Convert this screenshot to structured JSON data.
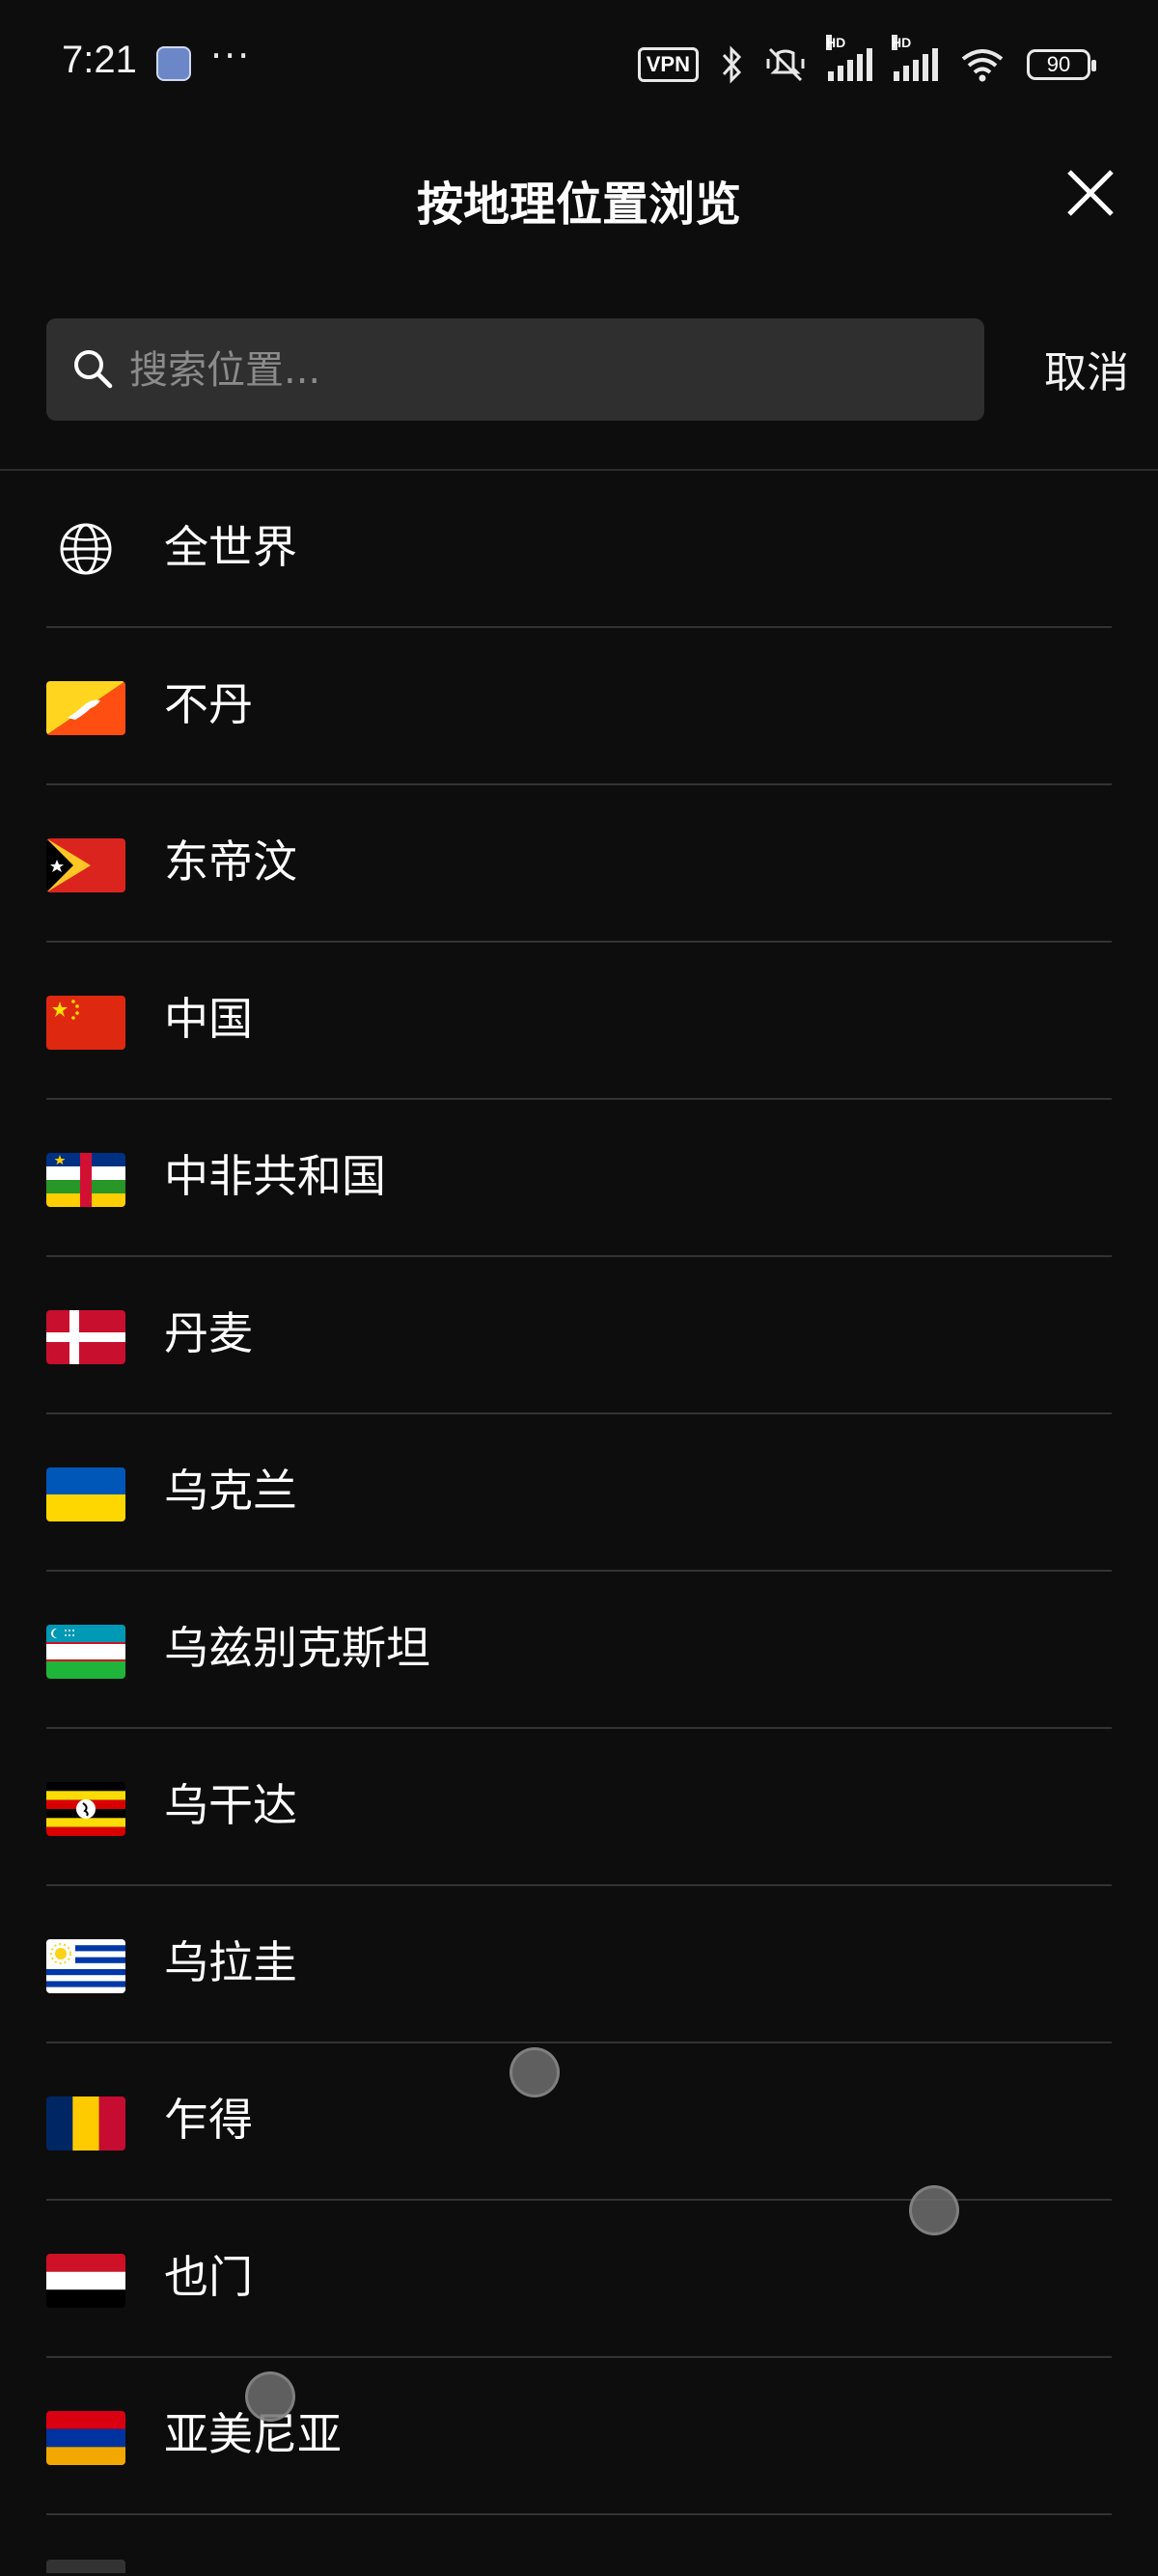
{
  "status_bar": {
    "time": "7:21",
    "app_icon": "news-app-icon",
    "overflow": "···",
    "vpn": "VPN",
    "hd1": "HD",
    "hd2": "HD",
    "battery": "90"
  },
  "header": {
    "title": "按地理位置浏览",
    "close_icon": "close-icon"
  },
  "search": {
    "placeholder": "搜索位置...",
    "value": "",
    "cancel_label": "取消"
  },
  "locations": [
    {
      "label": "全世界",
      "icon": "globe-icon"
    },
    {
      "label": "不丹",
      "icon": "flag-bhutan"
    },
    {
      "label": "东帝汶",
      "icon": "flag-timor-leste"
    },
    {
      "label": "中国",
      "icon": "flag-china"
    },
    {
      "label": "中非共和国",
      "icon": "flag-central-african-republic"
    },
    {
      "label": "丹麦",
      "icon": "flag-denmark"
    },
    {
      "label": "乌克兰",
      "icon": "flag-ukraine"
    },
    {
      "label": "乌兹别克斯坦",
      "icon": "flag-uzbekistan"
    },
    {
      "label": "乌干达",
      "icon": "flag-uganda"
    },
    {
      "label": "乌拉圭",
      "icon": "flag-uruguay"
    },
    {
      "label": "乍得",
      "icon": "flag-chad"
    },
    {
      "label": "也门",
      "icon": "flag-yemen"
    },
    {
      "label": "亚美尼亚",
      "icon": "flag-armenia"
    }
  ],
  "colors": {
    "background": "#0d0d0d",
    "search_bg": "#2f2f2f",
    "divider": "#333333",
    "text": "#ffffff",
    "placeholder": "#8b8b8b"
  }
}
